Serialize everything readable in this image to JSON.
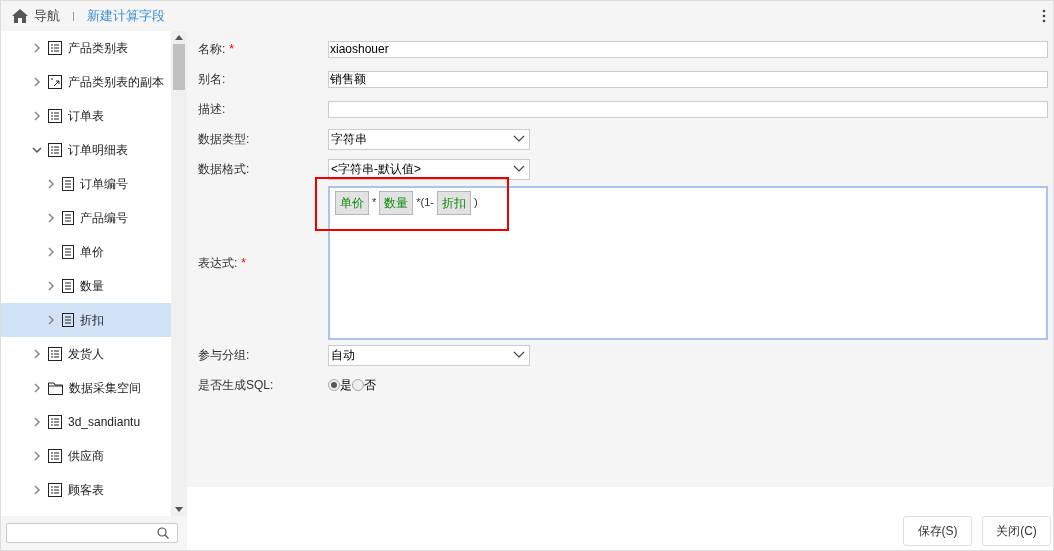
{
  "breadcrumb": {
    "home": "导航",
    "current": "新建计算字段"
  },
  "tree": [
    {
      "label": "产品类别表",
      "kind": "table",
      "expanded": false,
      "selected": false
    },
    {
      "label": "产品类别表的副本",
      "kind": "copy",
      "expanded": false,
      "selected": false
    },
    {
      "label": "订单表",
      "kind": "table",
      "expanded": false,
      "selected": false
    },
    {
      "label": "订单明细表",
      "kind": "table",
      "expanded": true,
      "selected": false,
      "children": [
        {
          "label": "订单编号",
          "kind": "field",
          "expanded": false,
          "selected": false
        },
        {
          "label": "产品编号",
          "kind": "field",
          "expanded": false,
          "selected": false
        },
        {
          "label": "单价",
          "kind": "field",
          "expanded": false,
          "selected": false
        },
        {
          "label": "数量",
          "kind": "field",
          "expanded": false,
          "selected": false
        },
        {
          "label": "折扣",
          "kind": "field",
          "expanded": false,
          "selected": true
        }
      ]
    },
    {
      "label": "发货人",
      "kind": "table",
      "expanded": false,
      "selected": false
    },
    {
      "label": "数据采集空间",
      "kind": "folder",
      "expanded": false,
      "selected": false
    },
    {
      "label": "3d_sandiantu",
      "kind": "table",
      "expanded": false,
      "selected": false
    },
    {
      "label": "供应商",
      "kind": "table",
      "expanded": false,
      "selected": false
    },
    {
      "label": "顾客表",
      "kind": "table",
      "expanded": false,
      "selected": false
    }
  ],
  "form": {
    "name": {
      "label": "名称:",
      "required": true,
      "value": "xiaoshouer"
    },
    "alias": {
      "label": "别名:",
      "value": "销售额"
    },
    "description": {
      "label": "描述:"
    },
    "data_type": {
      "label": "数据类型:",
      "value": "字符串"
    },
    "data_format": {
      "label": "数据格式:",
      "value": "<字符串-默认值>"
    },
    "expression": {
      "label": "表达式:",
      "required": true,
      "tokens": [
        {
          "kind": "field",
          "text": "单价"
        },
        {
          "kind": "text",
          "text": "*"
        },
        {
          "kind": "field",
          "text": "数量"
        },
        {
          "kind": "text",
          "text": "*(1-"
        },
        {
          "kind": "field",
          "text": "折扣"
        },
        {
          "kind": "text",
          "text": ")"
        }
      ]
    },
    "grouping": {
      "label": "参与分组:",
      "value": "自动"
    },
    "generate_sql": {
      "label": "是否生成SQL:",
      "options": [
        {
          "label": "是",
          "selected": true
        },
        {
          "label": "否",
          "selected": false
        }
      ]
    }
  },
  "buttons": [
    "保存(S)",
    "关闭(C)"
  ]
}
